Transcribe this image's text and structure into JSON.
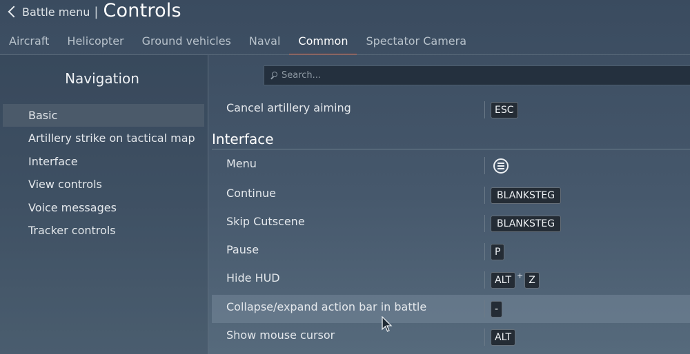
{
  "header": {
    "back_label": "Battle menu",
    "separator": "|",
    "title": "Controls"
  },
  "tabs": [
    {
      "label": "Aircraft"
    },
    {
      "label": "Helicopter"
    },
    {
      "label": "Ground vehicles"
    },
    {
      "label": "Naval"
    },
    {
      "label": "Common",
      "active": true
    },
    {
      "label": "Spectator Camera"
    }
  ],
  "navigation": {
    "title": "Navigation",
    "items": [
      {
        "label": "Basic",
        "active": true
      },
      {
        "label": "Artillery strike on tactical map"
      },
      {
        "label": "Interface"
      },
      {
        "label": "View controls"
      },
      {
        "label": "Voice messages"
      },
      {
        "label": "Tracker controls"
      }
    ]
  },
  "search": {
    "placeholder": "Search...",
    "value": ""
  },
  "controls": {
    "first_row": {
      "label": "Cancel artillery aiming",
      "keys": [
        "ESC"
      ]
    },
    "section_title": "Interface",
    "rows": [
      {
        "label": "Menu",
        "icon": "menu-circle-icon"
      },
      {
        "label": "Continue",
        "keys": [
          "BLANKSTEG"
        ]
      },
      {
        "label": "Skip Cutscene",
        "keys": [
          "BLANKSTEG"
        ]
      },
      {
        "label": "Pause",
        "keys": [
          "P"
        ]
      },
      {
        "label": "Hide HUD",
        "keys": [
          "ALT",
          "Z"
        ],
        "joiner": "+"
      },
      {
        "label": "Collapse/expand action bar in battle",
        "keys": [
          "-"
        ],
        "hovered": true
      },
      {
        "label": "Show mouse cursor",
        "keys": [
          "ALT"
        ]
      }
    ]
  },
  "colors": {
    "tab_active_underline": "#e05a34",
    "background": "#46586c"
  }
}
